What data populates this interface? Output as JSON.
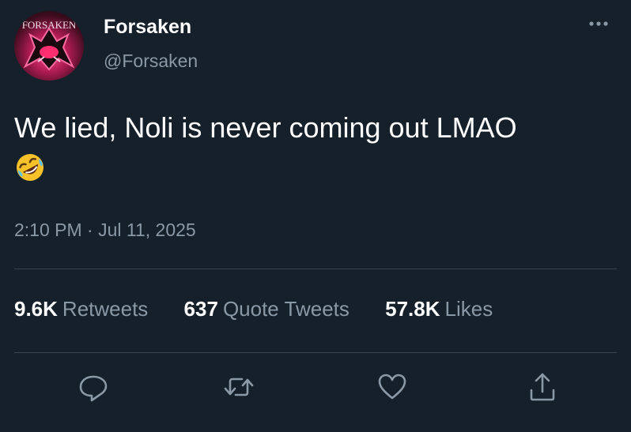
{
  "author": {
    "display_name": "Forsaken",
    "handle": "@Forsaken",
    "avatar_text": "FORSAKEN"
  },
  "tweet": {
    "text": "We lied, Noli is never coming out LMAO",
    "emoji": "rolling-on-the-floor-laughing-emoji"
  },
  "timestamp": "2:10 PM · Jul 11, 2025",
  "stats": {
    "retweets_count": "9.6K",
    "retweets_label": "Retweets",
    "quotes_count": "637",
    "quotes_label": "Quote Tweets",
    "likes_count": "57.8K",
    "likes_label": "Likes"
  },
  "icons": {
    "more": "more-dots-icon",
    "reply": "reply-icon",
    "retweet": "retweet-icon",
    "like": "heart-icon",
    "share": "share-icon"
  },
  "colors": {
    "background": "#15202b",
    "text_primary": "#ffffff",
    "text_secondary": "#8b98a5",
    "divider": "#38444d"
  }
}
